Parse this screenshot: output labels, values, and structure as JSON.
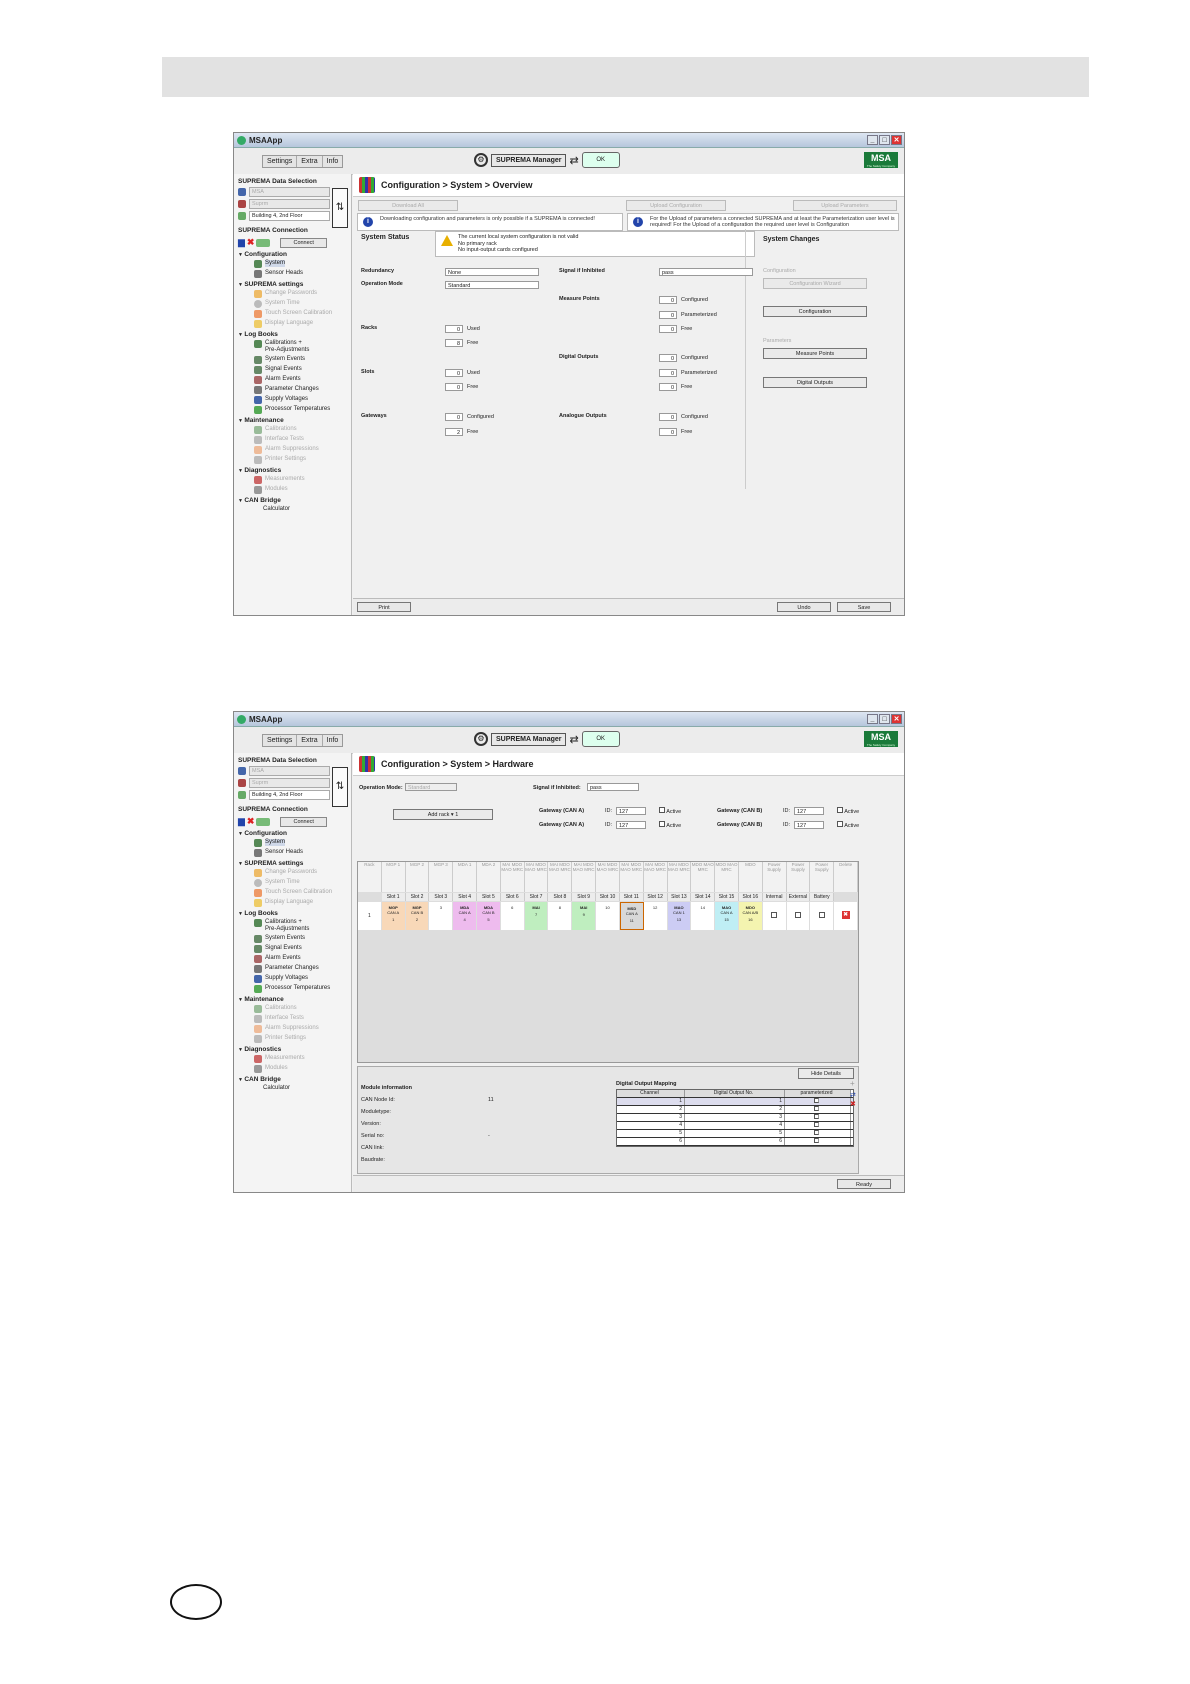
{
  "app": {
    "title": "MSAApp",
    "menu": [
      "Settings",
      "Extra",
      "Info"
    ],
    "manager_label": "SUPREMA Manager",
    "brand": "MSA",
    "brand_tagline": "The Safety Company",
    "monitor_label": "OK"
  },
  "sidebar": {
    "data_selection_title": "SUPREMA Data Selection",
    "select1": "MSA",
    "select2": "Suprm",
    "select3": "Building 4, 2nd Floor",
    "connection_title": "SUPREMA Connection",
    "connect_label": "Connect",
    "groups": {
      "configuration": {
        "title": "Configuration",
        "items": [
          "System",
          "Sensor Heads"
        ]
      },
      "suprema_settings": {
        "title": "SUPREMA settings",
        "items": [
          "Change Passwords",
          "System Time",
          "Touch Screen Calibration",
          "Display Language"
        ]
      },
      "log_books": {
        "title": "Log Books",
        "items": [
          "Calibrations +\nPre-Adjustments",
          "System Events",
          "Signal Events",
          "Alarm Events",
          "Parameter Changes",
          "Supply Voltages",
          "Processor Temperatures"
        ]
      },
      "maintenance": {
        "title": "Maintenance",
        "items": [
          "Calibrations",
          "Interface Tests",
          "Alarm Suppressions",
          "Printer Settings"
        ]
      },
      "diagnostics": {
        "title": "Diagnostics",
        "items": [
          "Measurements",
          "Modules"
        ]
      },
      "can_bridge": {
        "title": "CAN Bridge",
        "items": [
          "Calculator"
        ]
      }
    }
  },
  "overview": {
    "breadcrumb": "Configuration > System > Overview",
    "download_all": "Download All",
    "upload_configuration": "Upload Configuration",
    "upload_parameters": "Upload Parameters",
    "info_left": "Downloading configuration and parameters is only possible if a SUPREMA is connected!",
    "info_right": "For the Upload of parameters a connected SUPREMA and at least the Parameterization user level is required! For the Upload of a configuration the required user level is Configuration",
    "system_status_label": "System Status",
    "status_lines": [
      "The current local system configuration is not valid",
      "No primary rack",
      "No input-output cards configured"
    ],
    "redundancy_label": "Redundancy",
    "redundancy_value": "None",
    "operation_mode_label": "Operation  Mode",
    "operation_mode_value": "Standard",
    "signal_inhibited_label": "Signal if Inhibited",
    "signal_inhibited_value": "pass",
    "racks_label": "Racks",
    "racks_used": "0",
    "racks_free": "8",
    "slots_label": "Slots",
    "slots_used": "0",
    "slots_free": "0",
    "gateways_label": "Gateways",
    "gateways_configured": "0",
    "gateways_free": "2",
    "measure_points_label": "Measure Points",
    "mp_configured": "0",
    "mp_parameterized": "0",
    "mp_free": "0",
    "digital_outputs_label": "Digital Outputs",
    "do_configured": "0",
    "do_parameterized": "0",
    "do_free": "0",
    "analogue_outputs_label": "Analogue Outputs",
    "ao_configured": "0",
    "ao_free": "0",
    "word_used": "Used",
    "word_free": "Free",
    "word_configured": "Configured",
    "word_parameterized": "Parameterized",
    "system_changes_label": "System Changes",
    "configuration_head": "Configuration",
    "configuration_wizard": "Configuration Wizard",
    "configuration_btn": "Configuration",
    "parameters_head": "Parameters",
    "measure_points_btn": "Measure Points",
    "digital_outputs_btn": "Digital Outputs",
    "print": "Print",
    "undo": "Undo",
    "save": "Save"
  },
  "hardware": {
    "breadcrumb": "Configuration > System > Hardware",
    "operation_mode_label": "Operation Mode:",
    "operation_mode_value": "Standard",
    "signal_inhibited_label": "Signal if Inhibited:",
    "signal_inhibited_value": "pass",
    "add_rack": "Add rack",
    "add_rack_count": "1",
    "gateway_a": "Gateway (CAN A)",
    "gateway_b": "Gateway (CAN B)",
    "id_label": "ID:",
    "id_value": "127",
    "active_label": "Active",
    "columns": [
      "Rack",
      "MGP 1",
      "MGP 2",
      "MGP 3",
      "MDA 1",
      "MDA 2",
      "MAI MDO MAO MRC",
      "MAI MDO MAO MRC",
      "MAI MDO MAO MRC",
      "MAI MDO MAO MRC",
      "MAI MDO MAO MRC",
      "MAI MDO MAO MRC",
      "MAI MDO MAO MRC",
      "MAI MDO MAO MRC",
      "MDO MAO MRC",
      "MDO MAO MRC",
      "MDO",
      "Power Supply",
      "Power Supply",
      "Power Supply",
      "Delete"
    ],
    "slots": [
      "Slot 1",
      "Slot 2",
      "Slot 3",
      "Slot 4",
      "Slot 5",
      "Slot 6",
      "Slot 7",
      "Slot 8",
      "Slot 9",
      "Slot 10",
      "Slot 11",
      "Slot 12",
      "Slot 13",
      "Slot 14",
      "Slot 15",
      "Slot 16",
      "Internal",
      "External",
      "Battery"
    ],
    "rack_number": "1",
    "modules": [
      {
        "label": "MGP",
        "sub": "CAN A",
        "num": "1",
        "color": "#f8d8b8"
      },
      {
        "label": "MGP",
        "sub": "CAN B",
        "num": "2",
        "color": "#f8d8b8"
      },
      {
        "label": "",
        "sub": "",
        "num": "3",
        "color": "#ffffff"
      },
      {
        "label": "MDA",
        "sub": "CAN A",
        "num": "4",
        "color": "#eebbee"
      },
      {
        "label": "MDA",
        "sub": "CAN B",
        "num": "5",
        "color": "#eebbee"
      },
      {
        "label": "",
        "sub": "",
        "num": "6",
        "color": "#ffffff"
      },
      {
        "label": "MAI",
        "sub": "",
        "num": "7",
        "color": "#bfeebf"
      },
      {
        "label": "",
        "sub": "",
        "num": "8",
        "color": "#ffffff"
      },
      {
        "label": "MAI",
        "sub": "",
        "num": "9",
        "color": "#bfeebf"
      },
      {
        "label": "",
        "sub": "",
        "num": "10",
        "color": "#ffffff"
      },
      {
        "label": "MSD",
        "sub": "CAN A",
        "num": "11",
        "color": "#d8d8d8"
      },
      {
        "label": "",
        "sub": "",
        "num": "12",
        "color": "#ffffff"
      },
      {
        "label": "MAO",
        "sub": "CAN 1",
        "num": "13",
        "color": "#ccccf4"
      },
      {
        "label": "",
        "sub": "",
        "num": "14",
        "color": "#ffffff"
      },
      {
        "label": "MAO",
        "sub": "CAN A",
        "num": "15",
        "color": "#bfeef4"
      },
      {
        "label": "MDO",
        "sub": "CAN A/B",
        "num": "16",
        "color": "#f4f4b0"
      }
    ],
    "hide_details": "Hide Details",
    "module_info_title": "Module information",
    "module_info": [
      {
        "label": "CAN Node Id:",
        "value": "11"
      },
      {
        "label": "Moduletype:",
        "value": ""
      },
      {
        "label": "Version:",
        "value": ""
      },
      {
        "label": "Serial no:",
        "value": "-"
      },
      {
        "label": "CAN link:",
        "value": ""
      },
      {
        "label": "Baudrate:",
        "value": ""
      }
    ],
    "mapping_title": "Digital Output Mapping",
    "mapping_headers": [
      "Channel",
      "Digital Output No.",
      "parameterized"
    ],
    "mapping_rows": [
      [
        "1",
        "1"
      ],
      [
        "2",
        "2"
      ],
      [
        "3",
        "3"
      ],
      [
        "4",
        "4"
      ],
      [
        "5",
        "5"
      ],
      [
        "6",
        "6"
      ]
    ],
    "ready": "Ready"
  }
}
